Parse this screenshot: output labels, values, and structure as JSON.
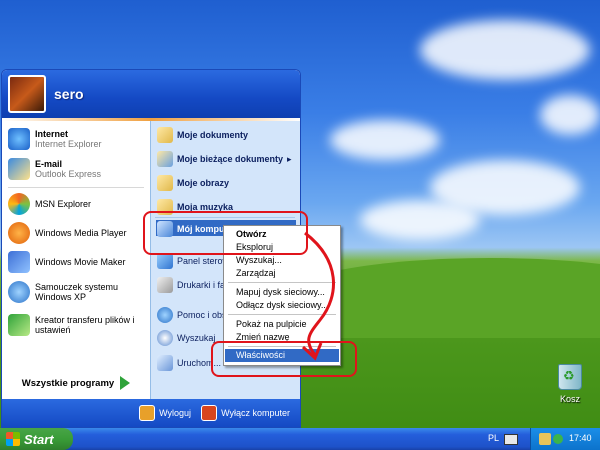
{
  "user": {
    "name": "sero"
  },
  "pinned": [
    {
      "title": "Internet",
      "subtitle": "Internet Explorer",
      "icon": "internet-explorer-icon"
    },
    {
      "title": "E-mail",
      "subtitle": "Outlook Express",
      "icon": "outlook-express-icon"
    }
  ],
  "recent_programs": [
    {
      "label": "MSN Explorer",
      "icon": "msn-explorer-icon"
    },
    {
      "label": "Windows Media Player",
      "icon": "media-player-icon"
    },
    {
      "label": "Windows Movie Maker",
      "icon": "movie-maker-icon"
    },
    {
      "label": "Samouczek systemu Windows XP",
      "icon": "tutorial-icon"
    },
    {
      "label": "Kreator transferu plików i ustawień",
      "icon": "transfer-wizard-icon"
    }
  ],
  "all_programs": "Wszystkie programy",
  "right_items": [
    {
      "label": "Moje dokumenty",
      "icon": "my-documents-icon"
    },
    {
      "label": "Moje bieżące dokumenty",
      "icon": "recent-documents-icon",
      "submenu": "▸"
    },
    {
      "label": "Moje obrazy",
      "icon": "my-pictures-icon"
    },
    {
      "label": "Moja muzyka",
      "icon": "my-music-icon"
    },
    {
      "label": "Mój komputer",
      "icon": "my-computer-icon"
    },
    {
      "label": "Panel sterowania",
      "icon": "control-panel-icon"
    },
    {
      "label": "Drukarki i faksy",
      "icon": "printers-icon"
    },
    {
      "label": "Pomoc i obsługa techniczna",
      "icon": "help-icon"
    },
    {
      "label": "Wyszukaj",
      "icon": "search-icon"
    },
    {
      "label": "Uruchom...",
      "icon": "run-icon"
    }
  ],
  "footer": {
    "logoff": "Wyloguj",
    "shutdown": "Wyłącz komputer"
  },
  "context_menu": {
    "items": [
      "Otwórz",
      "Eksploruj",
      "Wyszukaj...",
      "Zarządzaj",
      "Mapuj dysk sieciowy...",
      "Odłącz dysk sieciowy...",
      "Pokaż na pulpicie",
      "Zmień nazwę",
      "Właściwości"
    ],
    "highlighted": "Właściwości"
  },
  "desktop": {
    "recycle_bin": "Kosz"
  },
  "taskbar": {
    "start": "Start",
    "language": "PL",
    "time": "17:40"
  },
  "colors": {
    "annotation": "#e0141b",
    "selection": "#316ac5"
  }
}
